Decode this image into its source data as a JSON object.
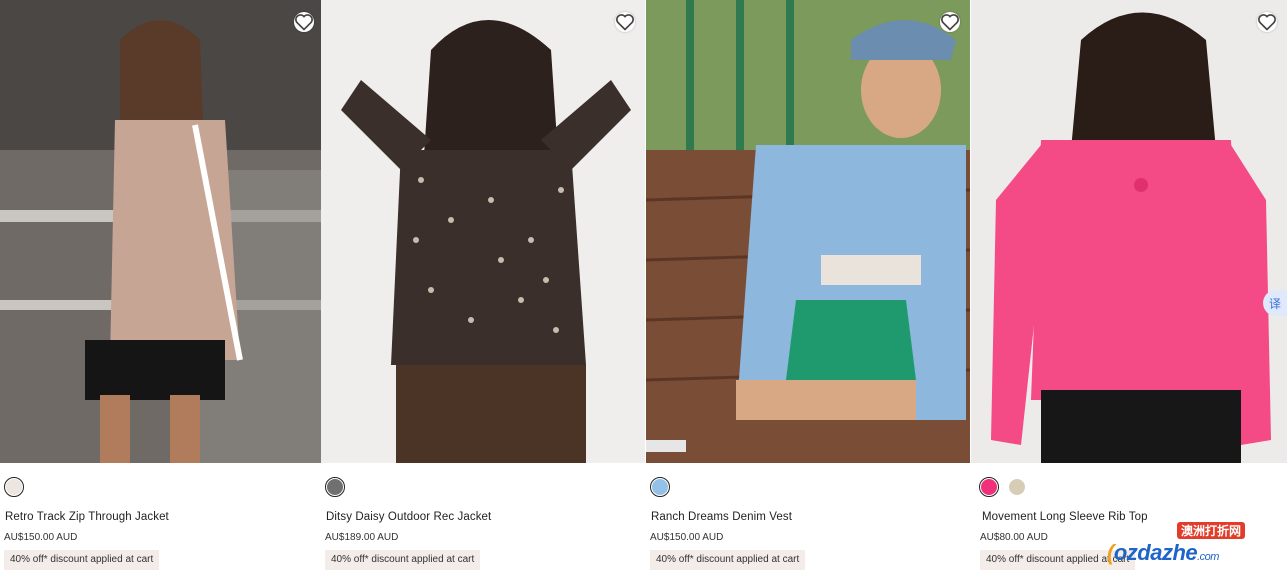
{
  "products": [
    {
      "name": "Retro Track Zip Through Jacket",
      "price": "AU$150.00 AUD",
      "promo": "40% off* discount applied at cart",
      "swatches": [
        "#ede6e0"
      ],
      "image_bg": "#8a8580"
    },
    {
      "name": "Ditsy Daisy Outdoor Rec Jacket",
      "price": "AU$189.00 AUD",
      "promo": "40% off* discount applied at cart",
      "swatches": [
        "#707070"
      ],
      "image_bg": "#efeeed"
    },
    {
      "name": "Ranch Dreams Denim Vest",
      "price": "AU$150.00 AUD",
      "promo": "40% off* discount applied at cart",
      "swatches": [
        "#93c1e8"
      ],
      "image_bg": "#6c5040"
    },
    {
      "name": "Movement Long Sleeve Rib Top",
      "price": "AU$80.00 AUD",
      "promo": "40% off* discount applied at cart",
      "swatches": [
        "#f0307a",
        "#d7ccb6"
      ],
      "image_bg": "#ecebea"
    }
  ],
  "icons": {
    "wishlist": "heart-outline-icon",
    "translate": "translate-icon"
  },
  "translate_label": "译",
  "watermark": {
    "cn": "澳洲打折网",
    "main": "ozdazhe",
    "suffix": ".com"
  }
}
